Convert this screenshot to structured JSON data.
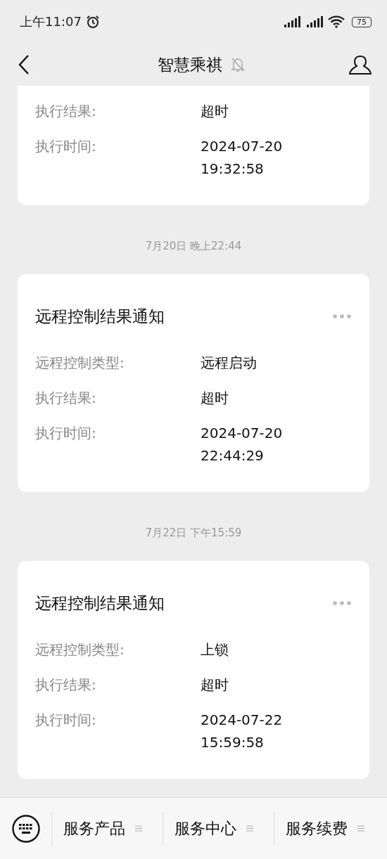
{
  "status_bar": {
    "time": "上午11:07",
    "battery": "75"
  },
  "header": {
    "title": "智慧乘祺"
  },
  "messages": [
    {
      "kind": "partial",
      "fields": [
        {
          "label": "执行结果:",
          "value": "超时"
        },
        {
          "label": "执行时间:",
          "value": "2024-07-20\n19:32:58"
        }
      ]
    },
    {
      "kind": "full",
      "timestamp": "7月20日 晚上22:44",
      "title": "远程控制结果通知",
      "fields": [
        {
          "label": "远程控制类型:",
          "value": "远程启动"
        },
        {
          "label": "执行结果:",
          "value": "超时"
        },
        {
          "label": "执行时间:",
          "value": "2024-07-20\n22:44:29"
        }
      ]
    },
    {
      "kind": "full",
      "timestamp": "7月22日 下午15:59",
      "title": "远程控制结果通知",
      "fields": [
        {
          "label": "远程控制类型:",
          "value": "上锁"
        },
        {
          "label": "执行结果:",
          "value": "超时"
        },
        {
          "label": "执行时间:",
          "value": "2024-07-22\n15:59:58"
        }
      ]
    }
  ],
  "menu": [
    "服务产品",
    "服务中心",
    "服务续费"
  ]
}
